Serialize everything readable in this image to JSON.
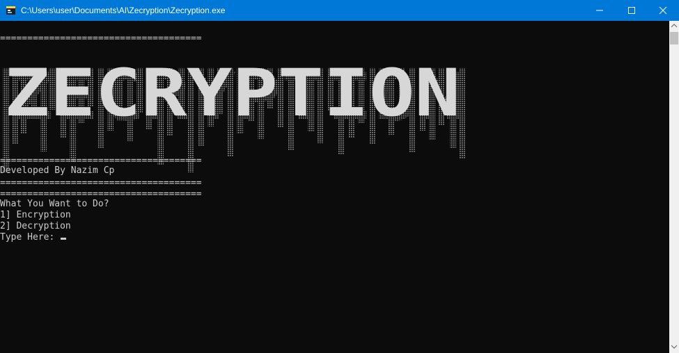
{
  "window": {
    "title": "C:\\Users\\user\\Documents\\AI\\Zecryption\\Zecryption.exe",
    "accent": "#0078d7"
  },
  "console": {
    "background": "#0c0c0c",
    "foreground": "#cccccc",
    "separator": "=====================================",
    "banner_text": "ZECRYPTION",
    "developer_line": "Developed By Nazim Cp",
    "prompt_question": "What You Want to Do?",
    "options": [
      "1] Encryption",
      "2] Decryption"
    ],
    "input_prompt": "Type Here: "
  },
  "icons": {
    "app": "console-app-icon",
    "minimize": "minimize-icon",
    "maximize": "maximize-icon",
    "close": "close-icon"
  }
}
